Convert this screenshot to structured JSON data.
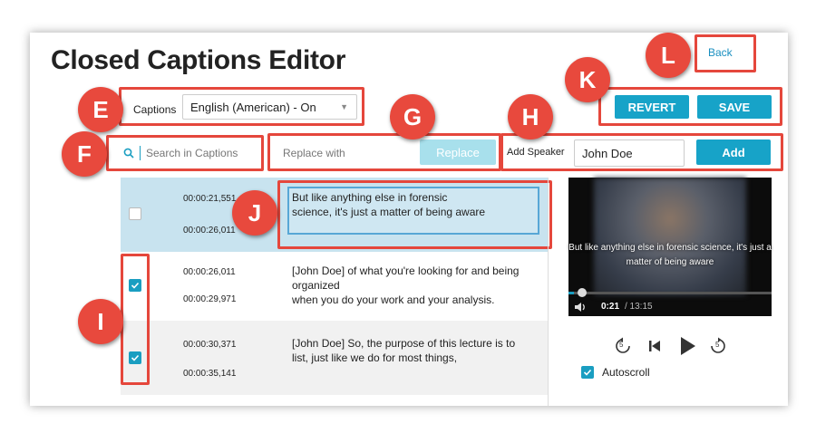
{
  "header": {
    "title": "Closed Captions Editor"
  },
  "toolbar": {
    "captions_label": "Captions",
    "captions_select": "English (American) - On",
    "search_placeholder": "Search in Captions",
    "replace_placeholder": "Replace with",
    "replace_label": "Replace",
    "add_speaker_label": "Add Speaker",
    "speaker_value": "John Doe",
    "add_label": "Add",
    "revert_label": "REVERT",
    "save_label": "SAVE",
    "back_label": "Back"
  },
  "captions": [
    {
      "start": "00:00:21,551",
      "end": "00:00:26,011",
      "line1": "But like anything else in forensic",
      "line2": "science, it's just a matter of being aware",
      "line3": "",
      "checked": false
    },
    {
      "start": "00:00:26,011",
      "end": "00:00:29,971",
      "line1": "[John Doe] of what you're looking for and being",
      "line2": "organized",
      "line3": "when you do your work and your analysis.",
      "checked": true
    },
    {
      "start": "00:00:30,371",
      "end": "00:00:35,141",
      "line1": "[John Doe] So, the purpose of this lecture is to",
      "line2": "list, just like we do for most things,",
      "line3": "",
      "checked": true
    }
  ],
  "player": {
    "subtitle_line1": "But like anything else in forensic science, it's just a",
    "subtitle_line2": "matter of being aware",
    "current_time": "0:21",
    "duration": "/ 13:15",
    "progress_fraction": 0.026,
    "rewind_seconds": "5",
    "forward_seconds": "5",
    "autoscroll_label": "Autoscroll"
  },
  "badges": {
    "E": "E",
    "F": "F",
    "G": "G",
    "H": "H",
    "I": "I",
    "J": "J",
    "K": "K",
    "L": "L"
  },
  "colors": {
    "accent": "#17a3c8",
    "annotation": "#e8493d",
    "selected_row": "#c8e3ef"
  }
}
